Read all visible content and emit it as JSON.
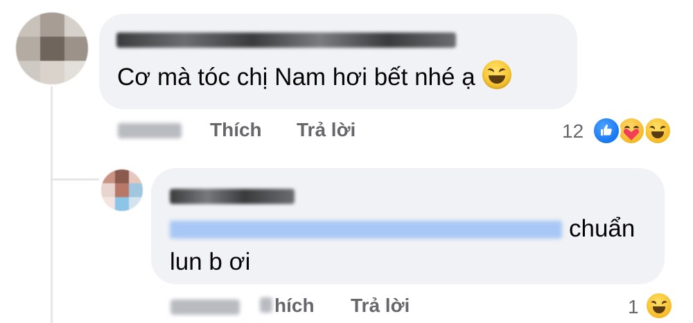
{
  "comment1": {
    "text": "Cơ mà tóc chị Nam hơi bết nhé ạ",
    "emoji_icon": "grinning-squinting-face-icon",
    "actions": {
      "like_label": "Thích",
      "reply_label": "Trả lời"
    },
    "reaction_count": "12",
    "reactions": [
      "like-icon",
      "care-icon",
      "haha-icon"
    ]
  },
  "reply1": {
    "text_line1": "chuẩn",
    "text_line2": "lun b ơi",
    "actions": {
      "like_label": "hích",
      "reply_label": "Trả lời"
    },
    "reaction_count": "1",
    "reactions": [
      "haha-icon"
    ]
  },
  "colors": {
    "bubble": "#f0f2f5",
    "secondary_text": "#65676b",
    "like_blue": "#1877f2",
    "mention_blue": "#a9c7f5"
  }
}
